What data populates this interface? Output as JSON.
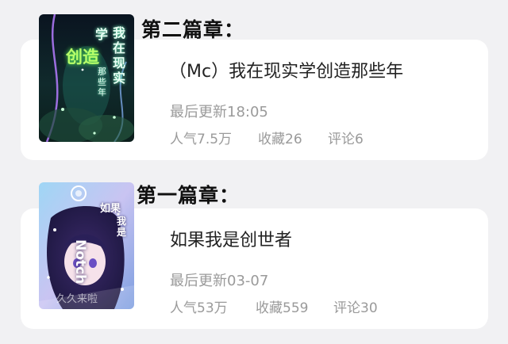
{
  "chapters": [
    {
      "heading": "第二篇章：",
      "book": {
        "title": "（Mc）我在现实学创造那些年",
        "updated": "最后更新18:05",
        "popularity": "人气7.5万",
        "favorites": "收藏26",
        "comments": "评论6",
        "cover": {
          "text_col1": "我在现实",
          "text_col2": "学",
          "text_big": "创造",
          "text_small": "那些年"
        }
      }
    },
    {
      "heading": "第一篇章：",
      "book": {
        "title": "如果我是创世者",
        "updated": "最后更新03-07",
        "popularity": "人气53万",
        "favorites": "收藏559",
        "comments": "评论30",
        "cover": {
          "text_ruguo": "如果",
          "text_woshi": "我是",
          "text_notch": "Notch",
          "text_watermark": "久久来啦"
        }
      }
    }
  ]
}
